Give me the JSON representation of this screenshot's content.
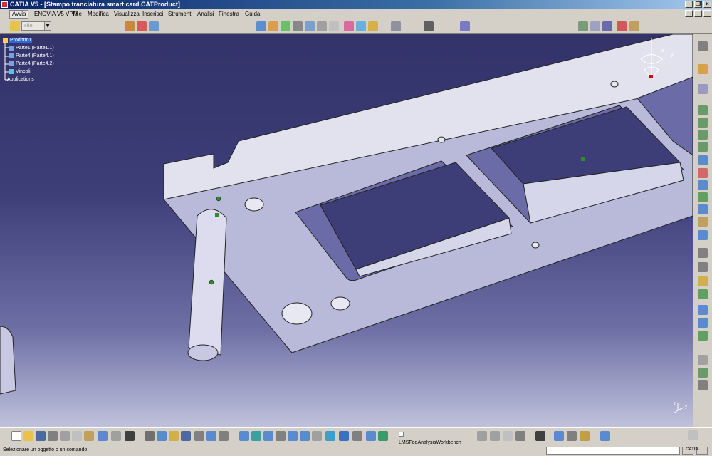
{
  "window": {
    "title": "CATIA V5 - [Stampo tranciatura smart card.CATProduct]",
    "minimize": "_",
    "restore": "❐",
    "close": "×"
  },
  "menubar": {
    "items": [
      "Avvia",
      "ENOVIA V5 VPM",
      "File",
      "Modifica",
      "Visualizza",
      "Inserisci",
      "Strumenti",
      "Analisi",
      "Finestra",
      "Guida"
    ]
  },
  "toolbar_top": {
    "file_combo": "File"
  },
  "tree": {
    "nodes": [
      {
        "label": "Prodotto1",
        "icon": "product-icon"
      },
      {
        "label": "Parte1 (Parte1.1)",
        "icon": "part-icon"
      },
      {
        "label": "Parte4 (Parte4.1)",
        "icon": "part-icon"
      },
      {
        "label": "Parte4 (Parte4.2)",
        "icon": "part-icon"
      },
      {
        "label": "Vincoli",
        "icon": "constraints-icon"
      },
      {
        "label": "Applications",
        "icon": "applications-icon"
      }
    ]
  },
  "compass": {
    "x_label": "x",
    "y_label": "y"
  },
  "axis_triad": {
    "z_label": "z",
    "y_label": "y"
  },
  "toolbar_bottom": {
    "workbench_label": "LMSFddAnalysisWorkbench"
  },
  "statusbar": {
    "message": "Selezionare un oggetto o un comando"
  },
  "brand": {
    "logo_text": "CATIA"
  },
  "colors": {
    "title_bar": "#0a246a",
    "viewport_top": "#33336a",
    "viewport_bottom": "#c0c2dc",
    "part_face": "#b9b9d9",
    "part_top": "#e2e2ee",
    "tree_selected": "#3168d6"
  }
}
